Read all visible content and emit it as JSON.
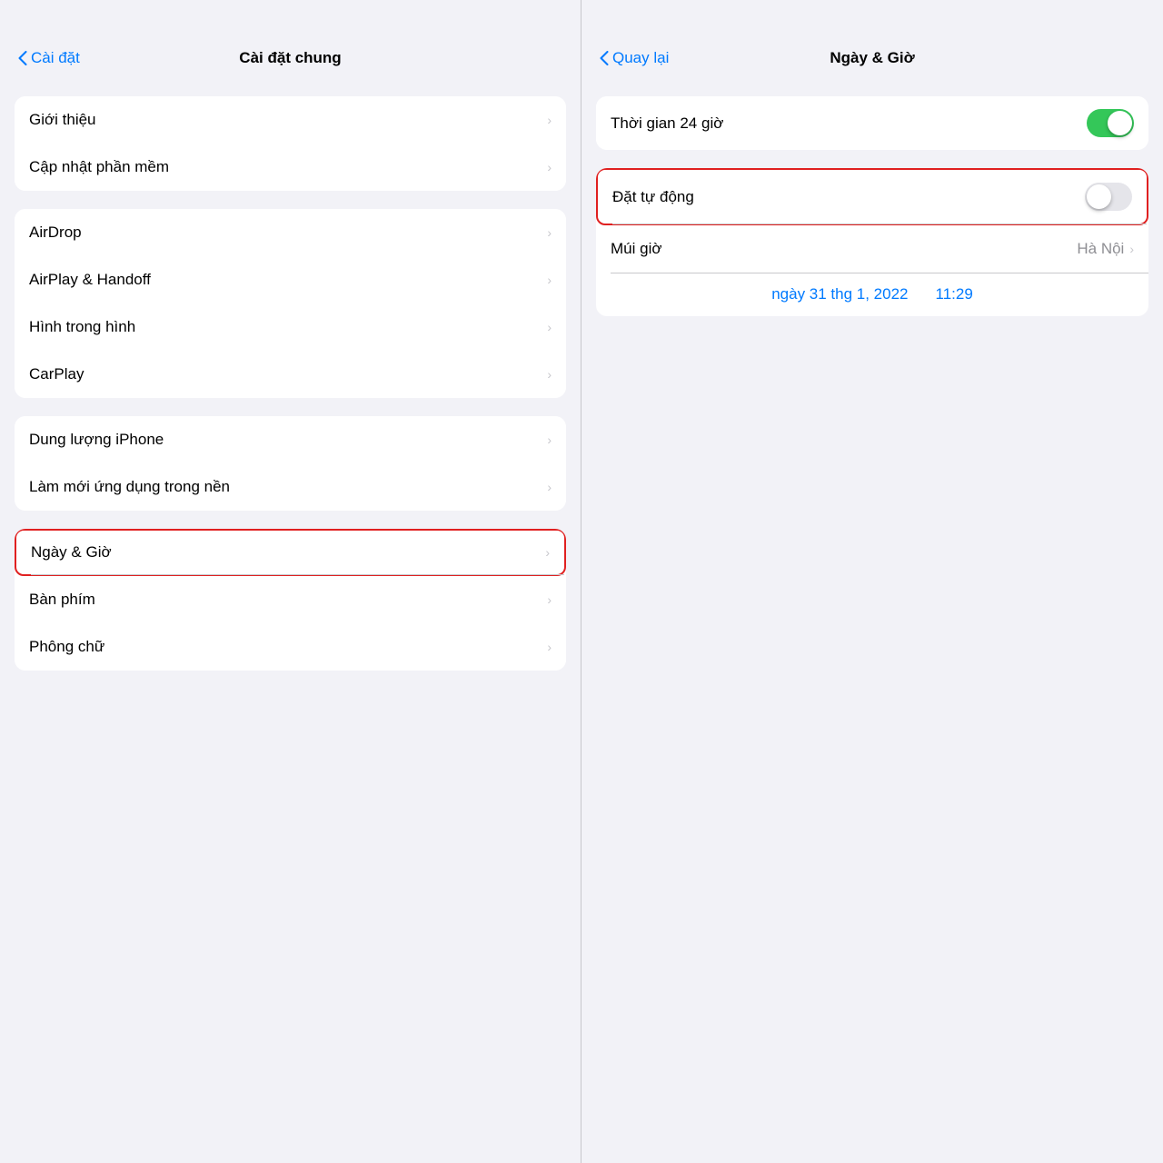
{
  "left": {
    "back_label": "Cài đặt",
    "title": "Cài đặt chung",
    "sections": [
      {
        "items": [
          {
            "id": "gioi-thieu",
            "label": "Giới thiệu",
            "has_chevron": true
          },
          {
            "id": "cap-nhat",
            "label": "Cập nhật phần mềm",
            "has_chevron": true
          }
        ]
      },
      {
        "items": [
          {
            "id": "airdrop",
            "label": "AirDrop",
            "has_chevron": true
          },
          {
            "id": "airplay",
            "label": "AirPlay & Handoff",
            "has_chevron": true
          },
          {
            "id": "hinh-trong-hinh",
            "label": "Hình trong hình",
            "has_chevron": true
          },
          {
            "id": "carplay",
            "label": "CarPlay",
            "has_chevron": true
          }
        ]
      },
      {
        "items": [
          {
            "id": "dung-luong",
            "label": "Dung lượng iPhone",
            "has_chevron": true
          },
          {
            "id": "lam-moi",
            "label": "Làm mới ứng dụng trong nền",
            "has_chevron": true
          }
        ]
      },
      {
        "items": [
          {
            "id": "ngay-gio",
            "label": "Ngày & Giờ",
            "has_chevron": true,
            "highlighted": true
          },
          {
            "id": "ban-phim",
            "label": "Bàn phím",
            "has_chevron": true
          },
          {
            "id": "phong-chu",
            "label": "Phông chữ",
            "has_chevron": true
          }
        ]
      }
    ]
  },
  "right": {
    "back_label": "Quay lại",
    "title": "Ngày & Giờ",
    "settings": {
      "thoi_gian_24_gio_label": "Thời gian 24 giờ",
      "thoi_gian_24_gio_state": "on",
      "dat_tu_dong_label": "Đặt tự động",
      "dat_tu_dong_state": "off",
      "mui_gio_label": "Múi giờ",
      "mui_gio_value": "Hà Nội",
      "date_value": "ngày 31 thg 1, 2022",
      "time_value": "11:29"
    }
  }
}
